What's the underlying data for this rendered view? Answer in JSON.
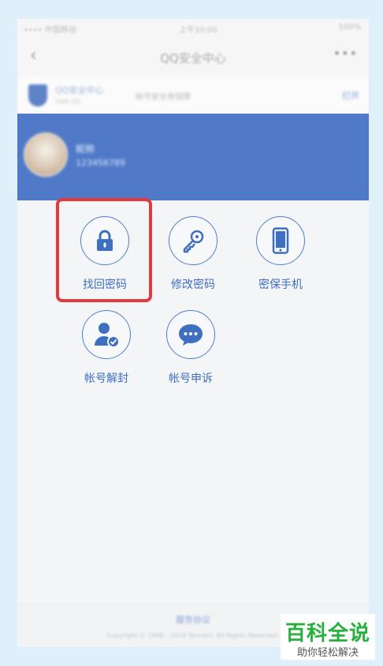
{
  "status_bar": {
    "left": "•••• 中国移动",
    "time": "上午10:00",
    "right": "100%"
  },
  "nav": {
    "title": "QQ安全中心",
    "back_icon": "chevron-left-icon",
    "more": "•••"
  },
  "banner": {
    "title": "QQ安全中心",
    "subtitle": "Safe QQ",
    "desc": "帐号安全有保障",
    "open": "打开"
  },
  "profile": {
    "name": "昵称",
    "qq": "123456789"
  },
  "grid": {
    "items": [
      {
        "label": "找回密码",
        "icon": "lock-icon"
      },
      {
        "label": "修改密码",
        "icon": "key-icon"
      },
      {
        "label": "密保手机",
        "icon": "phone-icon"
      },
      {
        "label": "帐号解封",
        "icon": "user-verified-icon"
      },
      {
        "label": "帐号申诉",
        "icon": "chat-bubble-icon"
      }
    ]
  },
  "footer": {
    "link": "服务协议",
    "copyright": "Copyright © 1998 - 2018 Tencent. All Rights Reserved."
  },
  "watermark": {
    "title": "百科全说",
    "slogan": "助你轻松解决"
  },
  "colors": {
    "primary": "#507ac8",
    "icon_blue": "#3f6fc0",
    "highlight_red": "#e33a40",
    "watermark_green": "#25b13b"
  }
}
